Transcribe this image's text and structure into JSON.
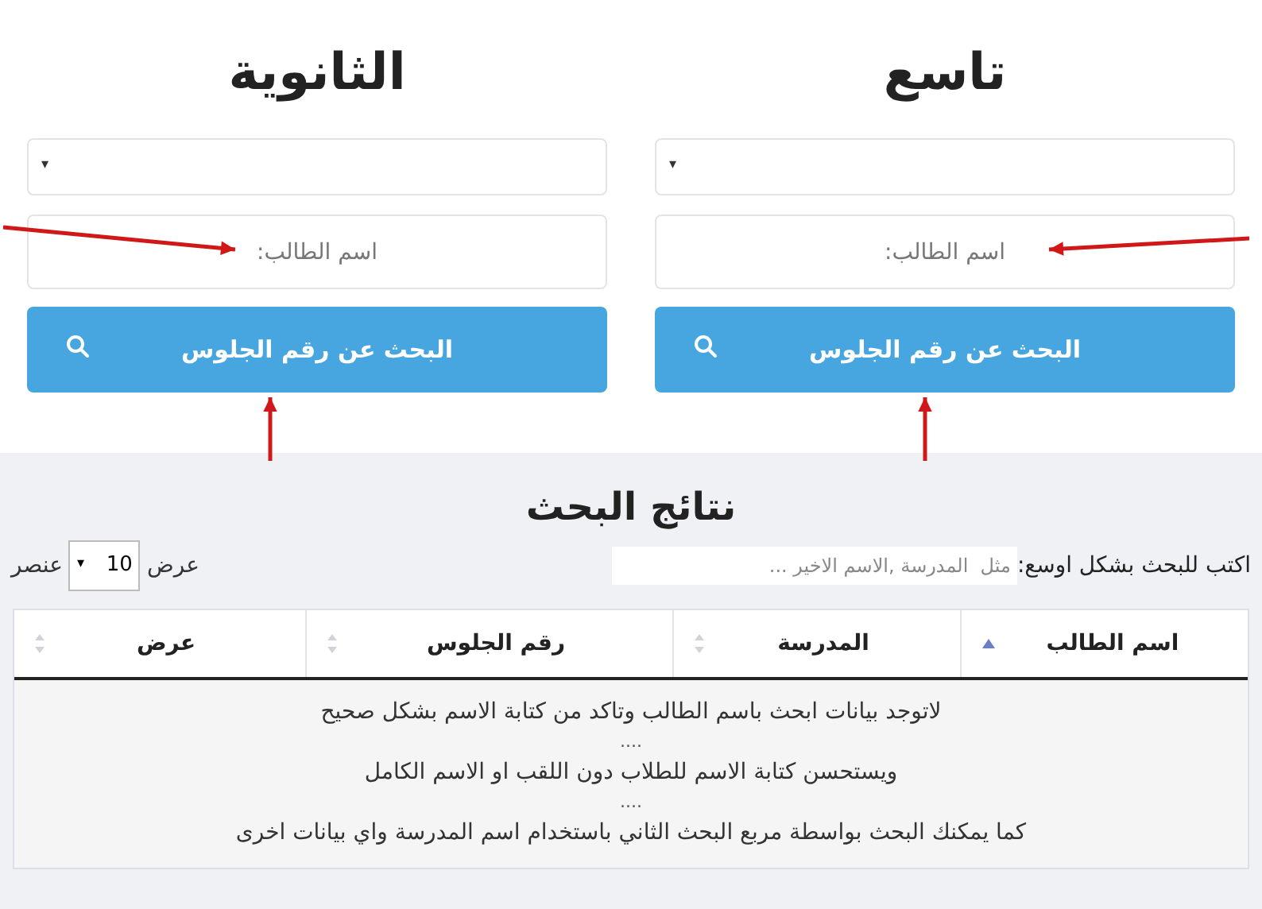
{
  "panels": [
    {
      "title": "تاسع",
      "select": {
        "value": "▾"
      },
      "name_field": {
        "placeholder": "اسم الطالب:"
      },
      "button": {
        "label": "البحث عن رقم الجلوس"
      }
    },
    {
      "title": "الثانوية",
      "select": {
        "value": "▾"
      },
      "name_field": {
        "placeholder": "اسم الطالب:"
      },
      "button": {
        "label": "البحث عن رقم الجلوس"
      }
    }
  ],
  "results": {
    "title": "نتائج البحث",
    "search": {
      "label": "اكتب للبحث بشكل اوسع:",
      "placeholder": "مثل  المدرسة ,الاسم الاخير ..."
    },
    "length": {
      "before": "عرض",
      "value": "10",
      "caret": "▾",
      "after": "عنصر"
    },
    "columns": [
      {
        "label": "اسم الطالب",
        "sorted": true
      },
      {
        "label": "المدرسة",
        "sorted": false
      },
      {
        "label": "رقم الجلوس",
        "sorted": false
      },
      {
        "label": "عرض",
        "sorted": false
      }
    ],
    "empty_lines": [
      "لاتوجد بيانات ابحث باسم الطالب وتاكد من كتابة الاسم بشكل صحيح",
      "....",
      "ويستحسن كتابة الاسم للطلاب دون اللقب او الاسم الكامل",
      "....",
      "كما يمكنك البحث بواسطة مربع البحث الثاني باستخدام اسم المدرسة واي بيانات اخرى"
    ]
  }
}
